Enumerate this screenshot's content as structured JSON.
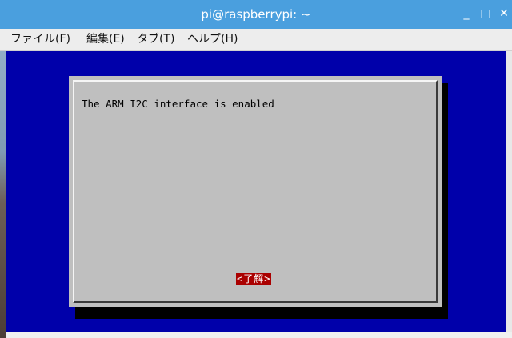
{
  "window": {
    "title": "pi@raspberrypi: ~",
    "minimize_glyph": "_",
    "maximize_glyph": "□",
    "close_glyph": "✕"
  },
  "menubar": {
    "items": [
      "ファイル(F)",
      "編集(E)",
      "タブ(T)",
      "ヘルプ(H)"
    ]
  },
  "dialog": {
    "message": "The ARM I2C interface is enabled",
    "ok_label": "<了解>"
  },
  "colors": {
    "titlebar": "#4a9fde",
    "terminal_bg": "#0000aa",
    "dialog_bg": "#bfbfbf",
    "button_bg": "#aa0000"
  }
}
